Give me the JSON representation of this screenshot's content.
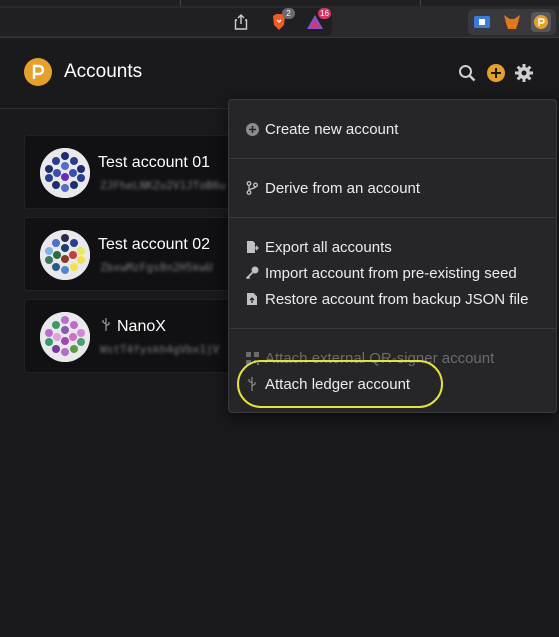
{
  "browser": {
    "brave_badge": "2",
    "rewards_badge": "16"
  },
  "header": {
    "title": "Accounts",
    "icons": [
      "search-icon",
      "add-icon",
      "gear-icon"
    ],
    "accent_color": "#e6a12c"
  },
  "accounts": [
    {
      "name": "Test account 01",
      "address": "ZJFheLNKZu2V1JToB6u",
      "is_ledger": false
    },
    {
      "name": "Test account 02",
      "address": "ZbxwMzFgs8n2H5kwU",
      "is_ledger": false
    },
    {
      "name": "NanoX",
      "address": "WstT4fyskh4gVbx1jV",
      "is_ledger": true
    }
  ],
  "menu": {
    "create": "Create new account",
    "derive": "Derive from an account",
    "export_all": "Export all accounts",
    "import_seed": "Import account from pre-existing seed",
    "restore_json": "Restore account from backup JSON file",
    "attach_qr": "Attach external QR-signer account",
    "attach_ledger": "Attach ledger account"
  },
  "highlight_color": "#e5e33b"
}
